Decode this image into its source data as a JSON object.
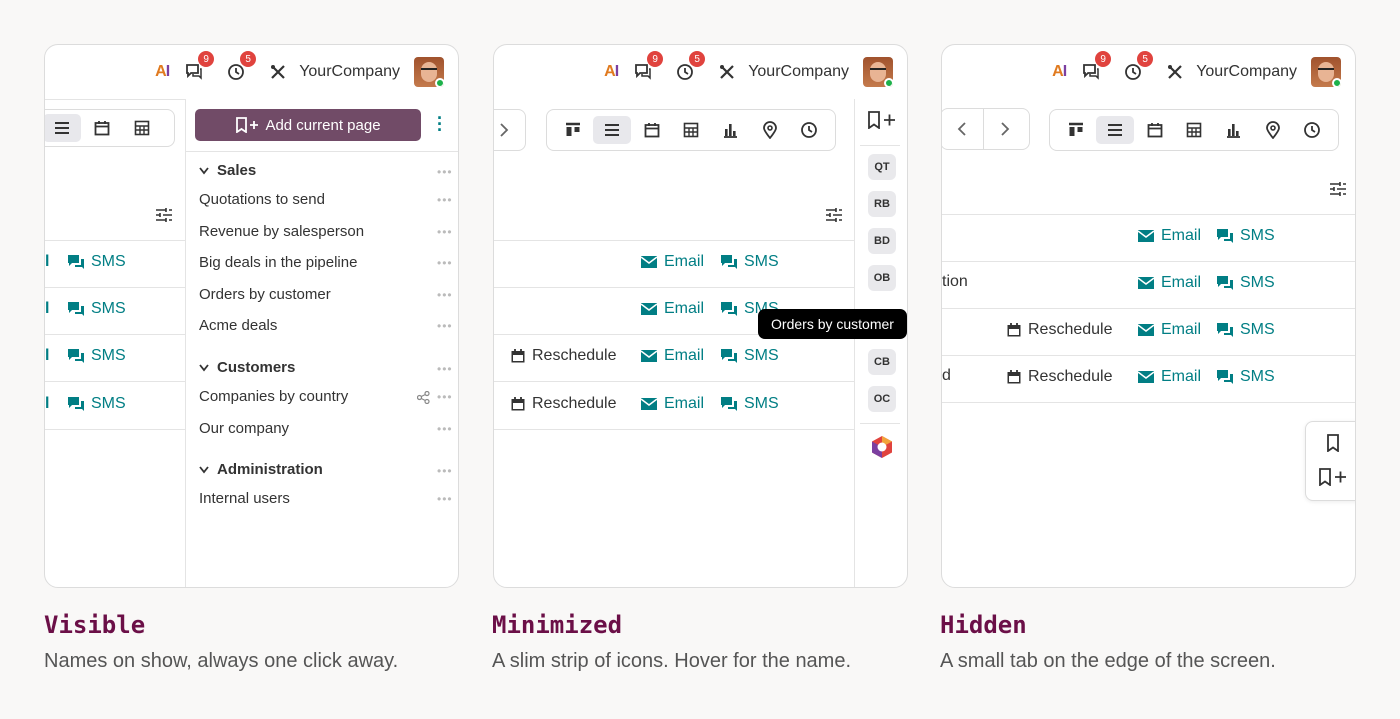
{
  "topbar": {
    "ai_a": "A",
    "ai_i": "I",
    "chat_badge": "9",
    "activity_badge": "5",
    "company": "YourCompany"
  },
  "icons": {
    "chat": "chat-icon",
    "clock": "clock-icon",
    "tools": "tools-icon",
    "list": "list-view-icon",
    "calendar": "calendar-view-icon",
    "pivot": "pivot-view-icon",
    "kanban": "kanban-view-icon",
    "graph": "graph-view-icon",
    "map": "map-view-icon",
    "activity": "activity-view-icon",
    "filter": "filter-settings-icon",
    "bookmark": "bookmark-icon",
    "bookmark_add": "bookmark-add-icon"
  },
  "actions": {
    "email": "Email",
    "sms": "SMS",
    "reschedule": "Reschedule"
  },
  "visible": {
    "add_button": "Add current page",
    "groups": [
      {
        "name": "Sales",
        "items": [
          "Quotations to send",
          "Revenue by salesperson",
          "Big deals in the pipeline",
          "Orders by customer",
          "Acme deals"
        ]
      },
      {
        "name": "Customers",
        "items": [
          "Companies by country",
          "Our company"
        ]
      },
      {
        "name": "Administration",
        "items": [
          "Internal users"
        ]
      }
    ]
  },
  "minimized": {
    "chips": [
      "QT",
      "RB",
      "BD",
      "OB",
      "CB",
      "OC"
    ],
    "tooltip": "Orders by customer"
  },
  "hidden": {
    "row1_text": "tion",
    "row3_text": "d"
  },
  "captions": [
    {
      "title": "Visible",
      "subtitle": "Names on show, always one click away."
    },
    {
      "title": "Minimized",
      "subtitle": "A slim strip of icons. Hover for the name."
    },
    {
      "title": "Hidden",
      "subtitle": "A small tab on the edge of the screen."
    }
  ],
  "colors": {
    "brand": "#714b67",
    "action": "#017e84",
    "caption": "#6b0f47",
    "badge": "#e0433e"
  }
}
